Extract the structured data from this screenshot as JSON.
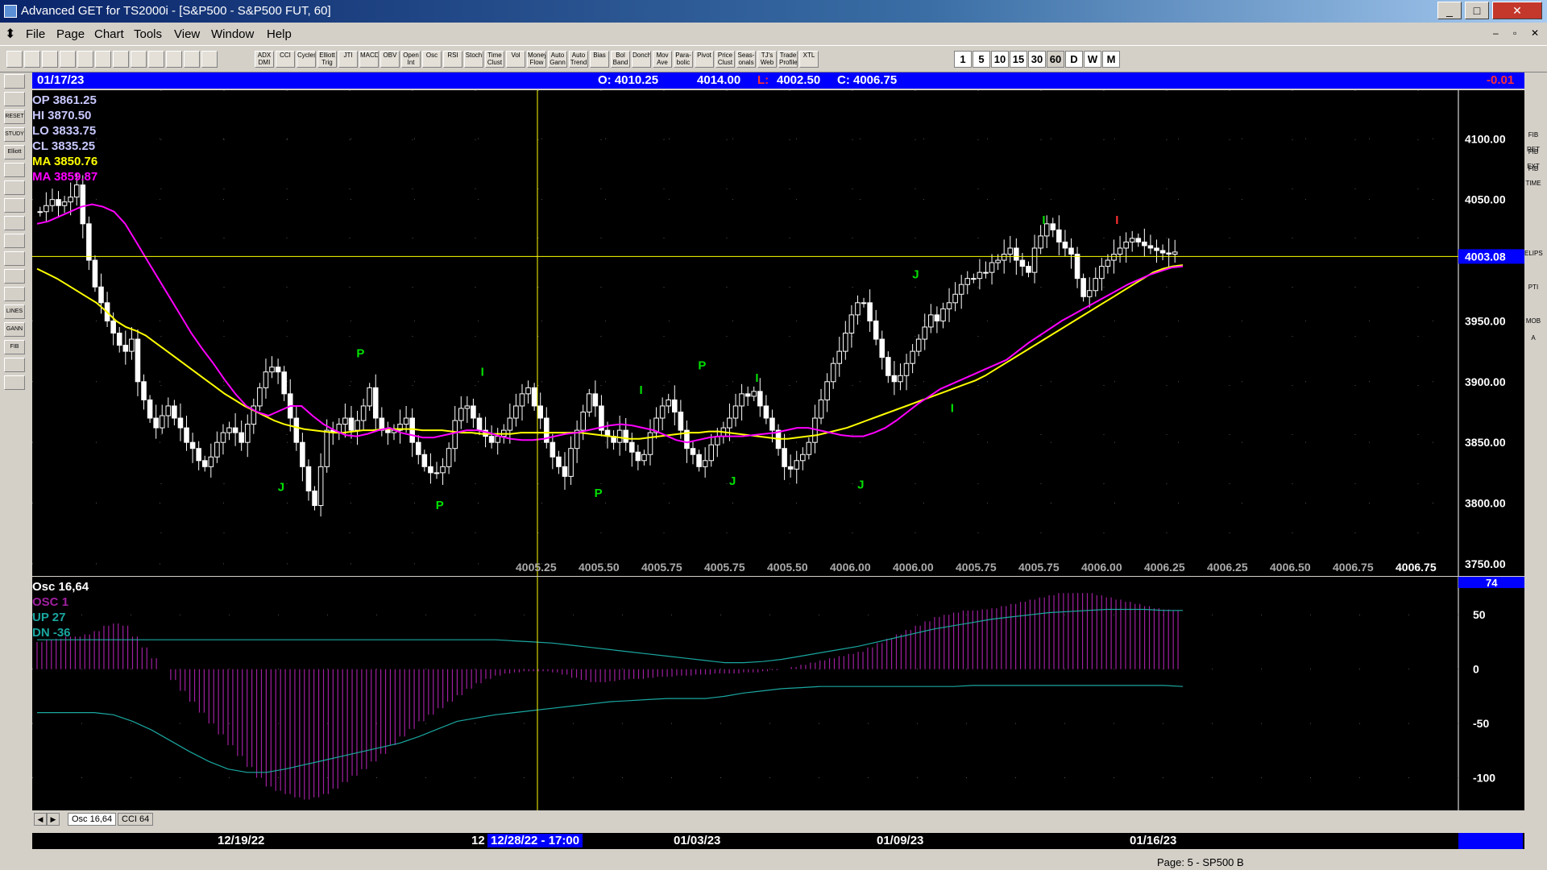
{
  "window": {
    "title": "Advanced GET for TS2000i - [S&P500 - S&P500 FUT, 60]"
  },
  "menu": [
    "File",
    "Page",
    "Chart",
    "Tools",
    "View",
    "Window",
    "Help"
  ],
  "toolbar": {
    "indicators": [
      "ADX DMI",
      "CCI",
      "Cycles",
      "Elliott Trig",
      "JTI",
      "MACD",
      "OBV",
      "Open Int",
      "Osc",
      "RSI",
      "Stoch",
      "Time Clust",
      "Vol",
      "Money Flow",
      "Auto Gann",
      "Auto Trend",
      "Bias",
      "Bol Band",
      "Donch",
      "Mov Ave",
      "Para-bolic",
      "Pivot",
      "Price Clust",
      "Seas-onals",
      "TJ's Web",
      "Trade Profile",
      "XTL"
    ],
    "timeframes": [
      "1",
      "5",
      "10",
      "15",
      "30",
      "60",
      "D",
      "W",
      "M"
    ]
  },
  "left_tools": [
    "",
    "",
    "RESET",
    "STUDY",
    "Elliott",
    "",
    "",
    "",
    "",
    "",
    "",
    "",
    "",
    "LINES",
    "GANN",
    "FIB",
    "",
    ""
  ],
  "right_tools": [
    "",
    "",
    "",
    "FIB RET",
    "FIB EXT",
    "FIB TIME",
    "",
    "",
    "",
    "",
    "ELIPS",
    "",
    "PTI",
    "",
    "MOB",
    "A",
    "",
    "",
    "",
    "",
    ""
  ],
  "infobar": {
    "date": "01/17/23",
    "open": "O: 4010.25",
    "high": "4014.00",
    "low_label": "L:",
    "low": "4002.50",
    "close": "C: 4006.75",
    "change": "-0.01"
  },
  "colors": {
    "yellow": "#ffff00",
    "magenta": "#ff00ff",
    "green": "#00ff00",
    "teal": "#1aa7a0",
    "osc": "#a020a0",
    "bg": "#000000",
    "info": "#0000ff"
  },
  "chart_data": [
    {
      "type": "candlestick",
      "panel": "price",
      "overlays": [
        {
          "label": "OP",
          "value": "3861.25"
        },
        {
          "label": "HI",
          "value": "3870.50"
        },
        {
          "label": "LO",
          "value": "3833.75"
        },
        {
          "label": "CL",
          "value": "3835.25"
        },
        {
          "label": "MA",
          "value": "3850.76"
        },
        {
          "label": "MA",
          "value": "3859.87"
        }
      ],
      "ylim": [
        3740,
        4140
      ],
      "yticks": [
        "4100.00",
        "4050.00",
        "3950.00",
        "3900.00",
        "3850.00",
        "3800.00",
        "3750.00"
      ],
      "ytick_values": [
        4100,
        4050,
        3950,
        3900,
        3850,
        3800,
        3750
      ],
      "current_price": "4003.08",
      "current_price_value": 4003.08,
      "bottom_labels": [
        "4005.25",
        "4005.50",
        "4005.75",
        "4005.75",
        "4005.50",
        "4006.00",
        "4006.00",
        "4005.75",
        "4005.75",
        "4006.00",
        "4006.25",
        "4006.25",
        "4006.50",
        "4006.75",
        "4006.75"
      ],
      "series": [
        {
          "name": "close",
          "points": [
            4040,
            4045,
            4050,
            4045,
            4048,
            4052,
            4062,
            4030,
            4000,
            3978,
            3965,
            3950,
            3940,
            3930,
            3925,
            3935,
            3900,
            3885,
            3870,
            3862,
            3872,
            3880,
            3870,
            3862,
            3850,
            3845,
            3835,
            3830,
            3838,
            3850,
            3858,
            3862,
            3858,
            3850,
            3865,
            3880,
            3895,
            3908,
            3912,
            3908,
            3890,
            3870,
            3850,
            3830,
            3810,
            3798,
            3830,
            3860,
            3858,
            3865,
            3870,
            3860,
            3868,
            3880,
            3895,
            3870,
            3860,
            3858,
            3860,
            3865,
            3870,
            3850,
            3840,
            3830,
            3825,
            3825,
            3830,
            3845,
            3868,
            3878,
            3880,
            3870,
            3860,
            3855,
            3850,
            3855,
            3860,
            3870,
            3880,
            3890,
            3895,
            3880,
            3870,
            3850,
            3838,
            3830,
            3822,
            3845,
            3860,
            3875,
            3890,
            3880,
            3860,
            3855,
            3850,
            3860,
            3850,
            3842,
            3835,
            3840,
            3858,
            3870,
            3880,
            3885,
            3875,
            3860,
            3845,
            3840,
            3830,
            3835,
            3848,
            3855,
            3862,
            3870,
            3880,
            3890,
            3888,
            3892,
            3880,
            3870,
            3860,
            3845,
            3830,
            3828,
            3835,
            3840,
            3850,
            3870,
            3885,
            3900,
            3915,
            3925,
            3940,
            3955,
            3965,
            3965,
            3950,
            3935,
            3920,
            3905,
            3900,
            3905,
            3915,
            3925,
            3935,
            3945,
            3955,
            3950,
            3960,
            3965,
            3972,
            3980,
            3985,
            3985,
            3990,
            3990,
            3998,
            4000,
            4005,
            4010,
            4000,
            3995,
            3990,
            4010,
            4020,
            4030,
            4025,
            4015,
            4010,
            4005,
            3985,
            3970,
            3975,
            3985,
            3995,
            4000,
            4005,
            4010,
            4015,
            4018,
            4015,
            4012,
            4010,
            4008,
            4006,
            4005,
            4006.75
          ],
          "color_hint": "white"
        },
        {
          "name": "MA yellow",
          "points": [
            3993,
            3989,
            3985,
            3980,
            3975,
            3970,
            3965,
            3958,
            3950,
            3945,
            3942,
            3938,
            3932,
            3926,
            3920,
            3914,
            3908,
            3902,
            3896,
            3890,
            3885,
            3880,
            3876,
            3872,
            3868,
            3865,
            3863,
            3861,
            3860,
            3859,
            3858,
            3858,
            3859,
            3860,
            3860,
            3861,
            3861,
            3861,
            3861,
            3860,
            3860,
            3860,
            3859,
            3858,
            3858,
            3857,
            3857,
            3857,
            3857,
            3858,
            3858,
            3858,
            3858,
            3858,
            3858,
            3858,
            3857,
            3856,
            3855,
            3854,
            3853,
            3853,
            3854,
            3855,
            3856,
            3857,
            3858,
            3858,
            3859,
            3859,
            3858,
            3857,
            3856,
            3855,
            3854,
            3853,
            3853,
            3854,
            3855,
            3856,
            3858,
            3860,
            3862,
            3865,
            3868,
            3871,
            3874,
            3877,
            3880,
            3883,
            3886,
            3889,
            3892,
            3895,
            3898,
            3901,
            3905,
            3910,
            3915,
            3920,
            3925,
            3930,
            3935,
            3940,
            3945,
            3950,
            3955,
            3960,
            3965,
            3970,
            3975,
            3980,
            3985,
            3990,
            3993,
            3995,
            3996
          ],
          "color_hint": "yellow"
        },
        {
          "name": "MA magenta",
          "points": [
            4030,
            4032,
            4036,
            4040,
            4044,
            4046,
            4044,
            4040,
            4030,
            4015,
            4000,
            3985,
            3970,
            3955,
            3940,
            3927,
            3915,
            3902,
            3890,
            3880,
            3875,
            3872,
            3876,
            3880,
            3880,
            3872,
            3865,
            3860,
            3856,
            3855,
            3857,
            3860,
            3862,
            3858,
            3856,
            3854,
            3854,
            3856,
            3858,
            3860,
            3860,
            3858,
            3855,
            3853,
            3852,
            3852,
            3853,
            3855,
            3857,
            3858,
            3860,
            3862,
            3864,
            3865,
            3864,
            3862,
            3860,
            3856,
            3852,
            3850,
            3852,
            3854,
            3855,
            3855,
            3855,
            3856,
            3857,
            3858,
            3860,
            3862,
            3862,
            3860,
            3858,
            3856,
            3855,
            3855,
            3858,
            3862,
            3868,
            3875,
            3882,
            3888,
            3894,
            3898,
            3902,
            3906,
            3910,
            3914,
            3918,
            3925,
            3932,
            3938,
            3944,
            3950,
            3955,
            3960,
            3965,
            3970,
            3975,
            3980,
            3984,
            3988,
            3991,
            3994,
            3995
          ],
          "color_hint": "magenta"
        }
      ],
      "markers": [
        {
          "label": "P",
          "color": "green",
          "at": "high"
        },
        {
          "label": "J",
          "color": "green",
          "at": "low"
        },
        {
          "label": "P",
          "color": "green",
          "at": "low"
        },
        {
          "label": "I",
          "color": "green",
          "at": "high"
        },
        {
          "label": "P",
          "color": "green",
          "at": "low"
        },
        {
          "label": "I",
          "color": "green",
          "at": "high"
        },
        {
          "label": "P",
          "color": "green",
          "at": "high"
        },
        {
          "label": "J",
          "color": "green",
          "at": "low"
        },
        {
          "label": "I",
          "color": "green",
          "at": "high"
        },
        {
          "label": "J",
          "color": "green",
          "at": "low"
        },
        {
          "label": "J",
          "color": "green",
          "at": "high"
        },
        {
          "label": "I",
          "color": "green",
          "at": "low"
        },
        {
          "label": "I",
          "color": "green",
          "at": "high"
        },
        {
          "label": "I",
          "color": "red",
          "at": "high"
        }
      ],
      "marker_values": [
        3920,
        3810,
        3795,
        3905,
        3805,
        3890,
        3910,
        3815,
        3900,
        3812,
        3985,
        3875,
        4030,
        4030
      ],
      "marker_index": [
        53,
        40,
        66,
        73,
        92,
        99,
        109,
        114,
        118,
        135,
        144,
        150,
        165,
        177
      ]
    },
    {
      "type": "bar",
      "panel": "oscillator",
      "overlays": [
        {
          "label": "Osc 16,64",
          "value": ""
        },
        {
          "label": "OSC",
          "value": "1"
        },
        {
          "label": "UP",
          "value": "27"
        },
        {
          "label": "DN",
          "value": "-36"
        }
      ],
      "current_value": "74",
      "ylim": [
        -130,
        85
      ],
      "yticks": [
        "50",
        "0",
        "-50",
        "-100"
      ],
      "ytick_values": [
        50,
        0,
        -50,
        -100
      ],
      "values": [
        25,
        27,
        28,
        30,
        30,
        32,
        35,
        40,
        42,
        40,
        30,
        20,
        10,
        0,
        -10,
        -20,
        -30,
        -40,
        -50,
        -60,
        -70,
        -80,
        -90,
        -100,
        -108,
        -112,
        -115,
        -118,
        -120,
        -118,
        -115,
        -110,
        -104,
        -98,
        -92,
        -85,
        -78,
        -70,
        -62,
        -55,
        -48,
        -42,
        -36,
        -30,
        -24,
        -18,
        -13,
        -9,
        -6,
        -4,
        -3,
        -2,
        -2,
        -2,
        -3,
        -5,
        -8,
        -10,
        -12,
        -12,
        -11,
        -10,
        -9,
        -9,
        -8,
        -7,
        -7,
        -6,
        -6,
        -5,
        -5,
        -4,
        -4,
        -4,
        -3,
        -3,
        -2,
        -1,
        0,
        2,
        4,
        6,
        8,
        10,
        12,
        14,
        16,
        20,
        24,
        28,
        32,
        36,
        40,
        44,
        48,
        50,
        52,
        54,
        54,
        55,
        56,
        58,
        60,
        62,
        64,
        66,
        68,
        70,
        70,
        70,
        70,
        68,
        66,
        64,
        62,
        60,
        58,
        56,
        55,
        54
      ],
      "series": [
        {
          "name": "UP",
          "values": [
            27,
            27,
            27,
            27,
            27,
            27,
            27,
            27,
            27,
            27,
            27,
            27,
            27,
            27,
            27,
            27,
            27,
            27,
            27,
            27,
            27,
            27,
            27,
            27,
            27,
            26,
            25,
            24,
            22,
            20,
            18,
            16,
            14,
            12,
            10,
            8,
            6,
            6,
            7,
            9,
            12,
            15,
            18,
            21,
            25,
            29,
            33,
            37,
            40,
            43,
            46,
            48,
            50,
            52,
            53,
            54,
            55,
            55,
            55,
            54,
            54
          ],
          "color_hint": "teal"
        },
        {
          "name": "DN",
          "values": [
            -40,
            -40,
            -40,
            -40,
            -42,
            -48,
            -56,
            -66,
            -76,
            -85,
            -92,
            -95,
            -95,
            -92,
            -88,
            -84,
            -80,
            -76,
            -72,
            -68,
            -62,
            -55,
            -48,
            -45,
            -42,
            -40,
            -38,
            -36,
            -34,
            -32,
            -30,
            -29,
            -28,
            -27,
            -27,
            -27,
            -25,
            -22,
            -20,
            -18,
            -17,
            -16,
            -16,
            -16,
            -16,
            -16,
            -16,
            -16,
            -16,
            -15,
            -15,
            -15,
            -15,
            -15,
            -15,
            -15,
            -15,
            -15,
            -15,
            -15,
            -16
          ],
          "color_hint": "teal"
        }
      ]
    }
  ],
  "tabs": [
    "Osc 16,64",
    "CCI 64"
  ],
  "datebar": {
    "dates": [
      "12/19/22",
      "12",
      "12/28/22 - 17:00",
      "01/03/23",
      "01/09/23",
      "01/16/23"
    ]
  },
  "status": {
    "page": "Page: 5 - SP500 B"
  }
}
